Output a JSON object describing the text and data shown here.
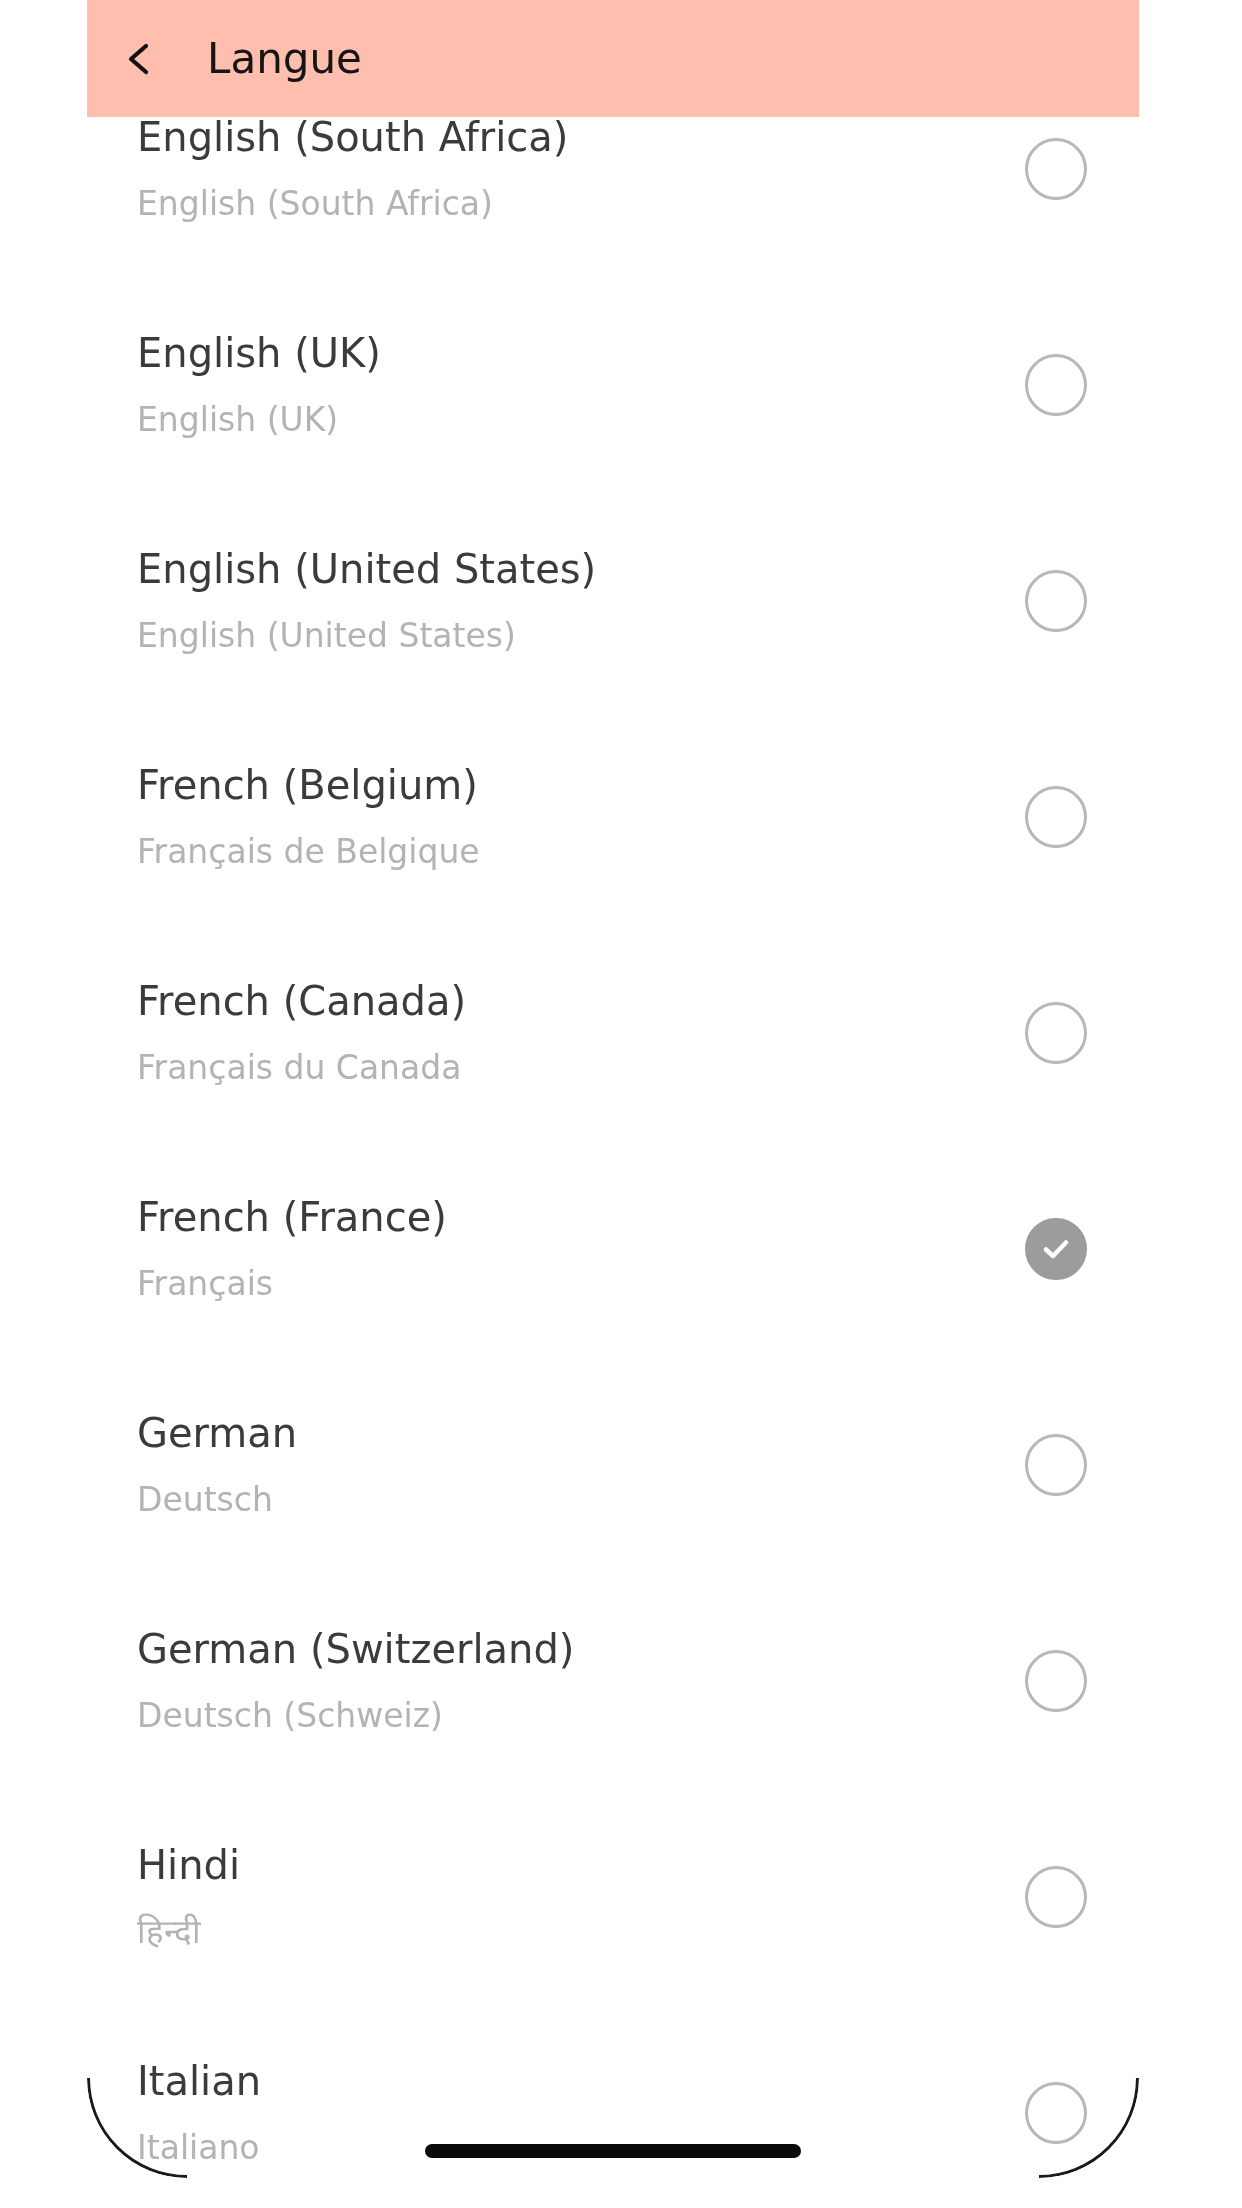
{
  "header": {
    "title": "Langue"
  },
  "languages": [
    {
      "name": "English (South Africa)",
      "native_name": "English (South Africa)",
      "selected": false
    },
    {
      "name": "English (UK)",
      "native_name": "English (UK)",
      "selected": false
    },
    {
      "name": "English (United States)",
      "native_name": "English (United States)",
      "selected": false
    },
    {
      "name": "French (Belgium)",
      "native_name": "Français de Belgique",
      "selected": false
    },
    {
      "name": "French (Canada)",
      "native_name": "Français du Canada",
      "selected": false
    },
    {
      "name": "French (France)",
      "native_name": "Français",
      "selected": true
    },
    {
      "name": "German",
      "native_name": "Deutsch",
      "selected": false
    },
    {
      "name": "German (Switzerland)",
      "native_name": "Deutsch (Schweiz)",
      "selected": false
    },
    {
      "name": "Hindi",
      "native_name": "हिन्दी",
      "selected": false
    },
    {
      "name": "Italian",
      "native_name": "Italiano",
      "selected": false
    }
  ]
}
